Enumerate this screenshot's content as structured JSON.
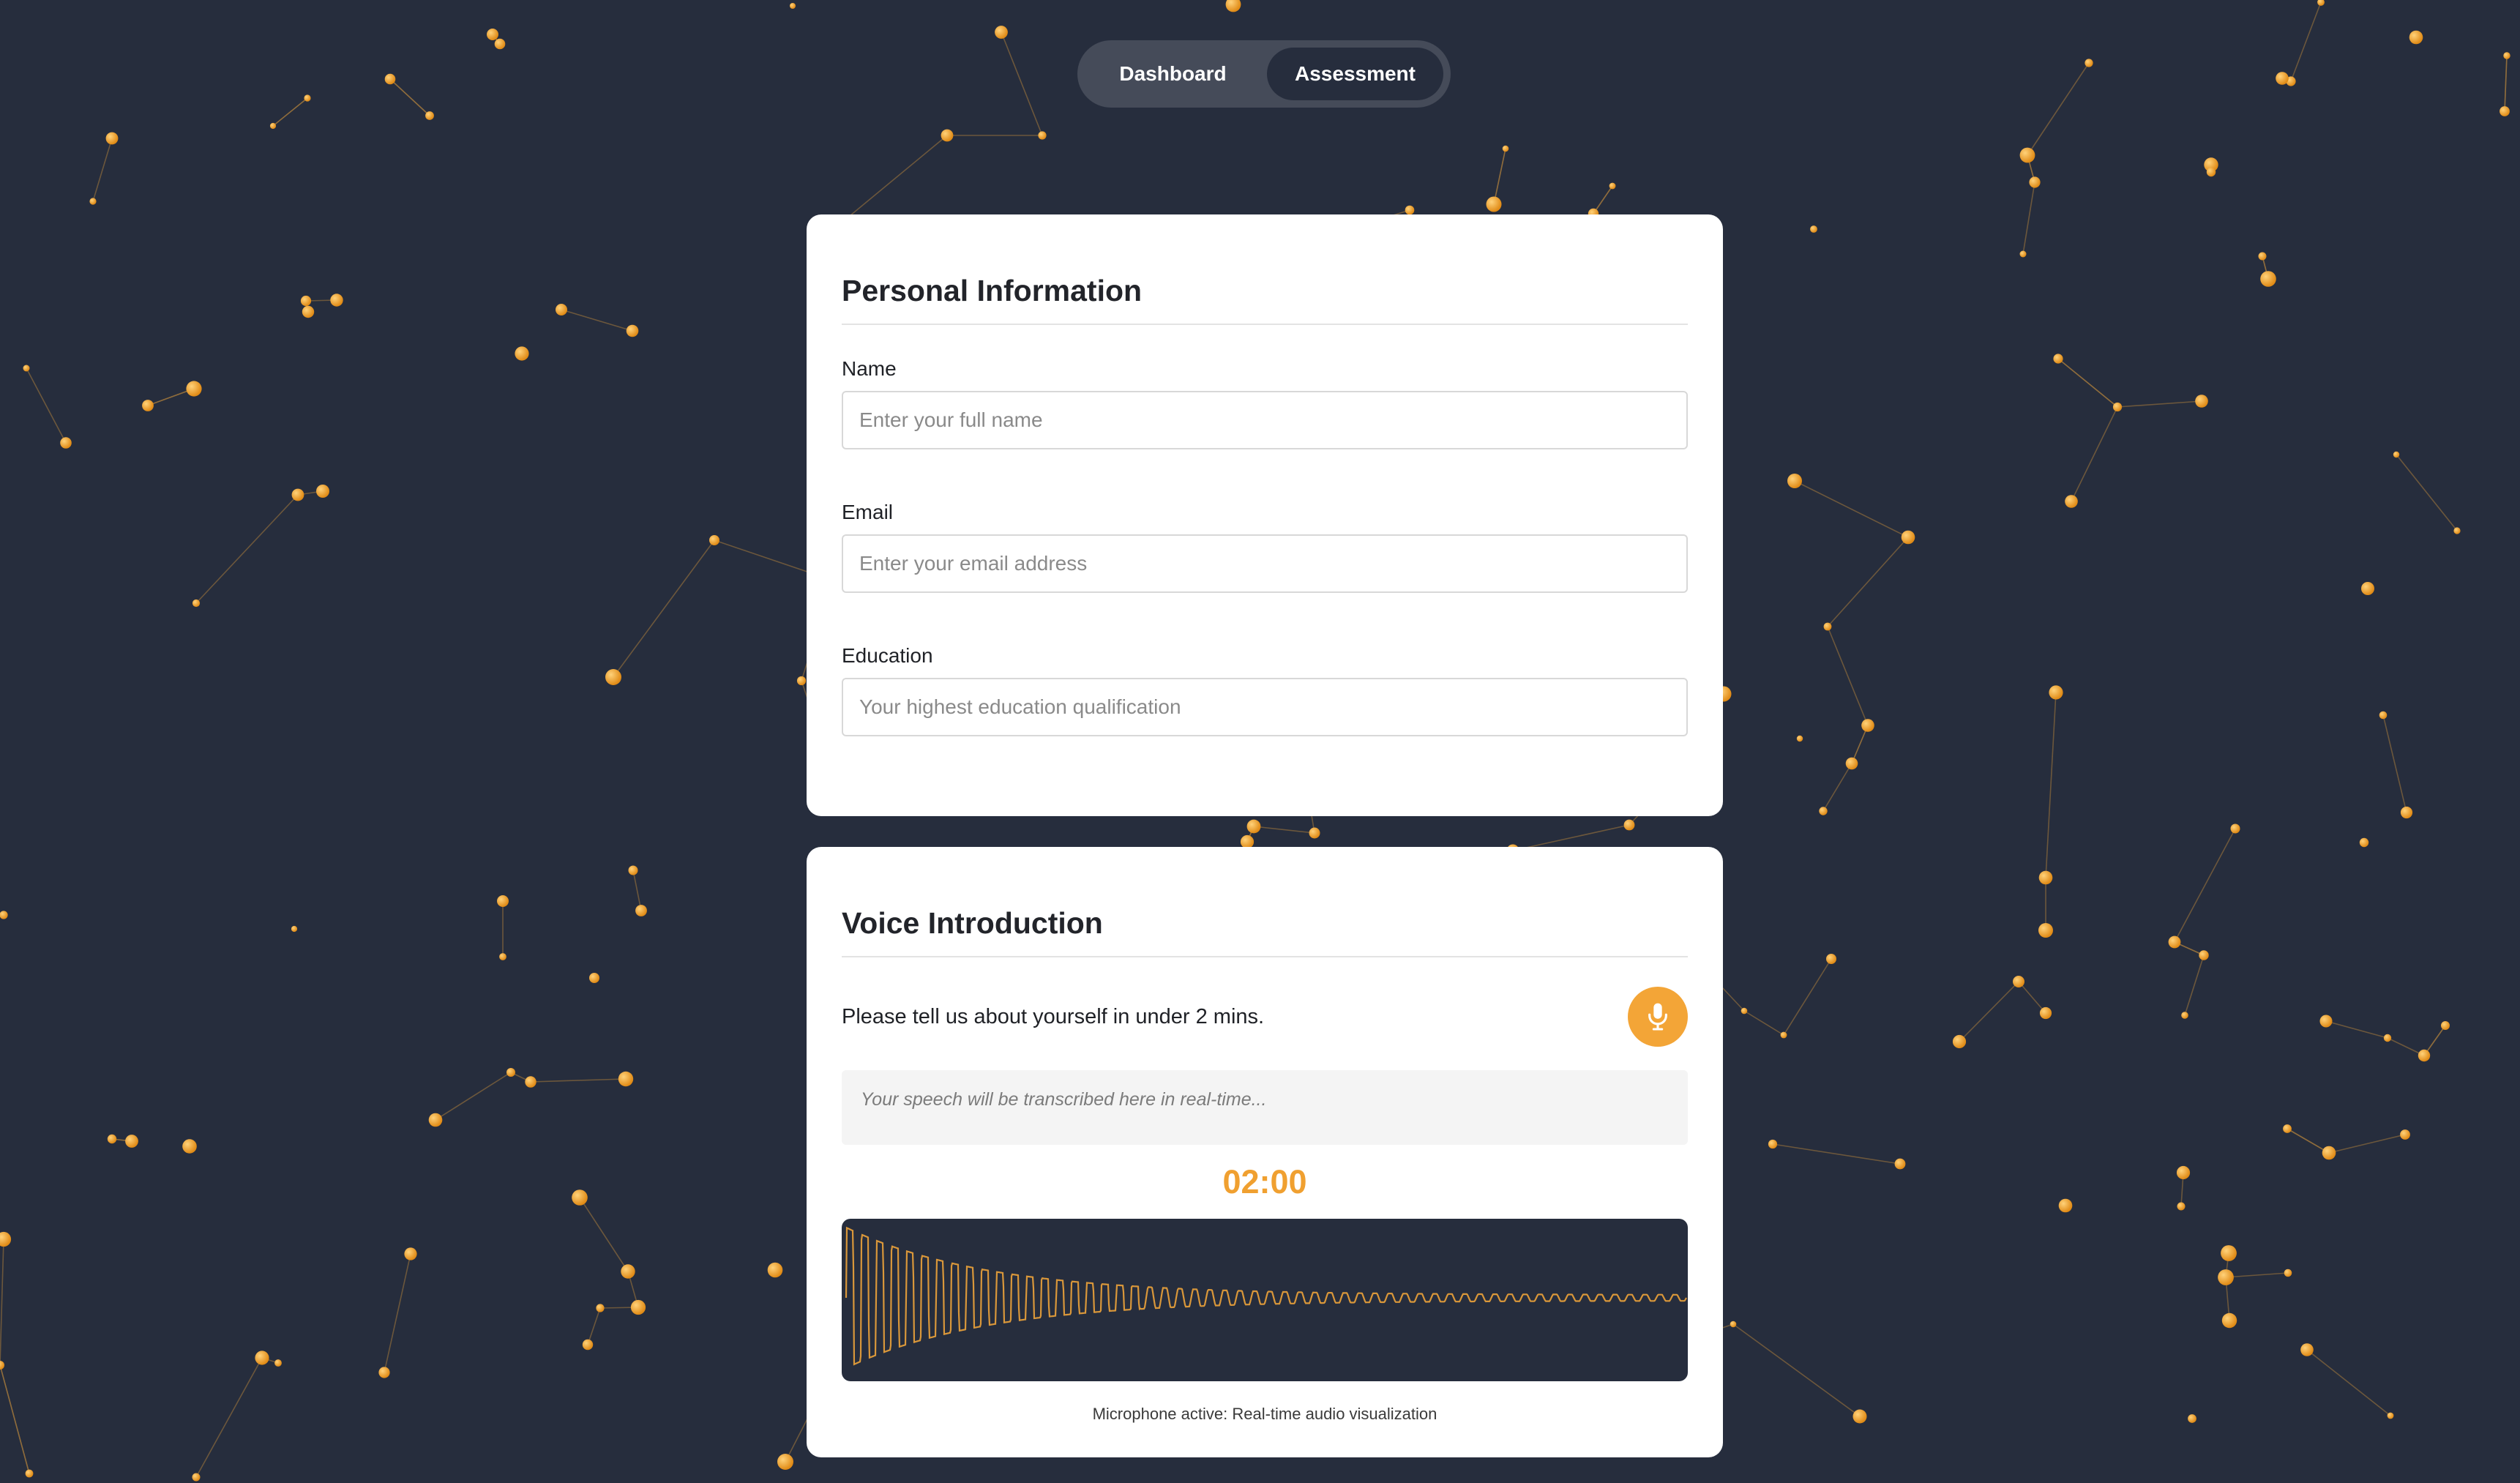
{
  "nav": {
    "tabs": [
      {
        "label": "Dashboard",
        "active": false
      },
      {
        "label": "Assessment",
        "active": true
      }
    ]
  },
  "personal": {
    "title": "Personal Information",
    "fields": {
      "name": {
        "label": "Name",
        "value": "",
        "placeholder": "Enter your full name"
      },
      "email": {
        "label": "Email",
        "value": "",
        "placeholder": "Enter your email address"
      },
      "education": {
        "label": "Education",
        "value": "",
        "placeholder": "Your highest education qualification"
      }
    }
  },
  "voice": {
    "title": "Voice Introduction",
    "prompt": "Please tell us about yourself in under 2 mins.",
    "mic_icon": "microphone-icon",
    "transcript_placeholder": "Your speech will be transcribed here in real-time...",
    "timer": "02:00",
    "status": "Microphone active: Real-time audio visualization"
  },
  "colors": {
    "background": "#262d3d",
    "accent": "#f3a537",
    "card": "#ffffff"
  }
}
